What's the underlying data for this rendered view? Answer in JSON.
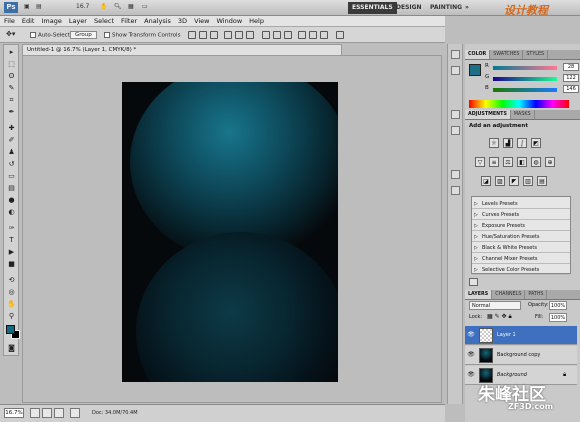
{
  "app": {
    "logo": "Ps",
    "zoom_label": "16.7",
    "view_label": "▾"
  },
  "workspaces": {
    "essentials": "ESSENTIALS",
    "design": "DESIGN",
    "painting": "PAINTING",
    "more": "»"
  },
  "watermark": {
    "top": "设计教程",
    "logo_cn": "朱峰社区",
    "logo_url": "ZF3D.com"
  },
  "menu": [
    "File",
    "Edit",
    "Image",
    "Layer",
    "Select",
    "Filter",
    "Analysis",
    "3D",
    "View",
    "Window",
    "Help"
  ],
  "options": {
    "auto_select_label": "Auto-Select:",
    "auto_select_value": "Group",
    "transform_label": "Show Transform Controls"
  },
  "document": {
    "tab_title": "Untitled-1 @ 16.7% (Layer 1, CMYK/8) *"
  },
  "status": {
    "zoom": "16.7%",
    "doc_info": "Doc: 34.0M/70.4M"
  },
  "color_panel": {
    "tabs": [
      "COLOR",
      "SWATCHES",
      "STYLES"
    ],
    "r_label": "R",
    "g_label": "G",
    "b_label": "B",
    "r": "28",
    "g": "122",
    "b": "146",
    "fg_color": "#1c6f86"
  },
  "adjustments": {
    "tabs": [
      "ADJUSTMENTS",
      "MASKS"
    ],
    "title": "Add an adjustment",
    "presets": [
      "Levels Presets",
      "Curves Presets",
      "Exposure Presets",
      "Hue/Saturation Presets",
      "Black & White Presets",
      "Channel Mixer Presets",
      "Selective Color Presets"
    ]
  },
  "layers_panel": {
    "tabs": [
      "LAYERS",
      "CHANNELS",
      "PATHS"
    ],
    "blend_mode": "Normal",
    "opacity_label": "Opacity:",
    "opacity": "100%",
    "lock_label": "Lock:",
    "fill_label": "Fill:",
    "fill": "100%",
    "layers": [
      {
        "name": "Layer 1",
        "selected": true
      },
      {
        "name": "Background copy",
        "selected": false
      },
      {
        "name": "Background",
        "selected": false
      }
    ]
  }
}
